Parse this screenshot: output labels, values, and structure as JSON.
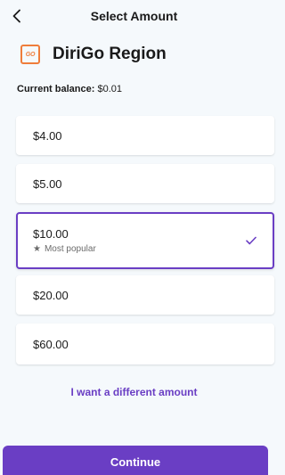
{
  "header": {
    "title": "Select Amount",
    "back_icon": "chevron-left-icon"
  },
  "agency": {
    "name": "DiriGo Region",
    "logo_text": "GO",
    "logo_color": "#ef7d3b"
  },
  "balance": {
    "label": "Current balance:",
    "value": "$0.01"
  },
  "options": [
    {
      "amount": "$4.00",
      "selected": false
    },
    {
      "amount": "$5.00",
      "selected": false
    },
    {
      "amount": "$10.00",
      "selected": true,
      "tag": "Most popular",
      "tag_icon": "star-icon"
    },
    {
      "amount": "$20.00",
      "selected": false
    },
    {
      "amount": "$60.00",
      "selected": false
    }
  ],
  "different_amount_label": "I want a different amount",
  "continue_label": "Continue",
  "colors": {
    "accent": "#6a3ec4",
    "background": "#f5f9fc"
  }
}
